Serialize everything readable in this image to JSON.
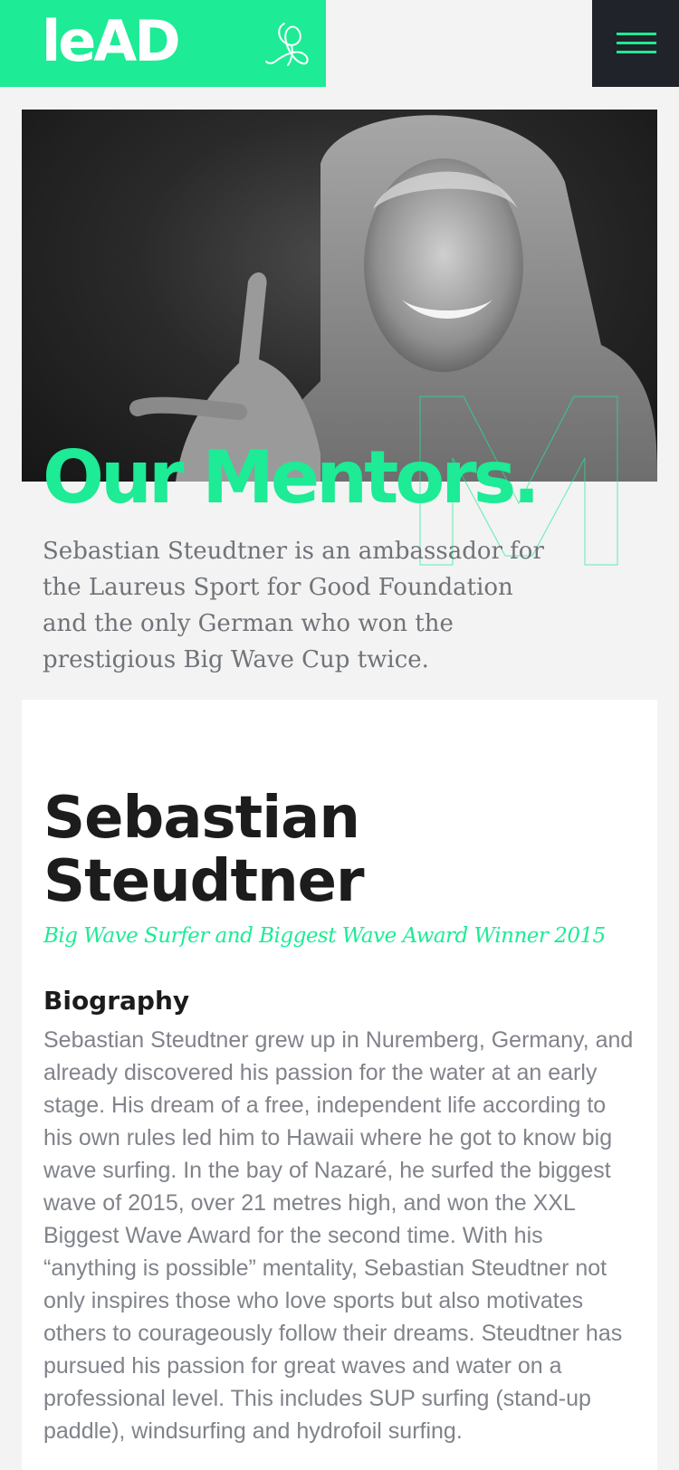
{
  "header": {
    "logo_text": "leAD",
    "brand_color": "#1deb95",
    "menu_icon": "hamburger-menu-icon",
    "signature_icon": "signature-icon"
  },
  "hero": {
    "title": "Our Mentors.",
    "outline_letter": "M",
    "description": "Sebastian Steudtner is an ambassador for the Laureus Sport for Good Foundation and the only German who won the prestigious Big Wave Cup twice."
  },
  "mentor": {
    "name": "Sebastian Steudtner",
    "role": "Big Wave Surfer and Biggest Wave Award Winner 2015",
    "biography_heading": "Biography",
    "biography_text": "Sebastian Steudtner grew up in Nuremberg, Germany, and already discovered his passion for the water at an early stage. His dream of a free, independent life according to his own rules led him to Hawaii where he got to know big wave surfing. In the bay of Nazaré, he surfed the biggest wave of 2015, over 21 metres high, and won the XXL Biggest Wave Award for the second time. With his “anything is possible” mentality, Sebastian Steudtner not only inspires those who love sports but also motivates others to courageously follow their dreams. Steudtner has pursued his passion for great waves and water on a professional level. This includes SUP surfing (stand-up paddle), windsurfing and hydrofoil surfing."
  }
}
